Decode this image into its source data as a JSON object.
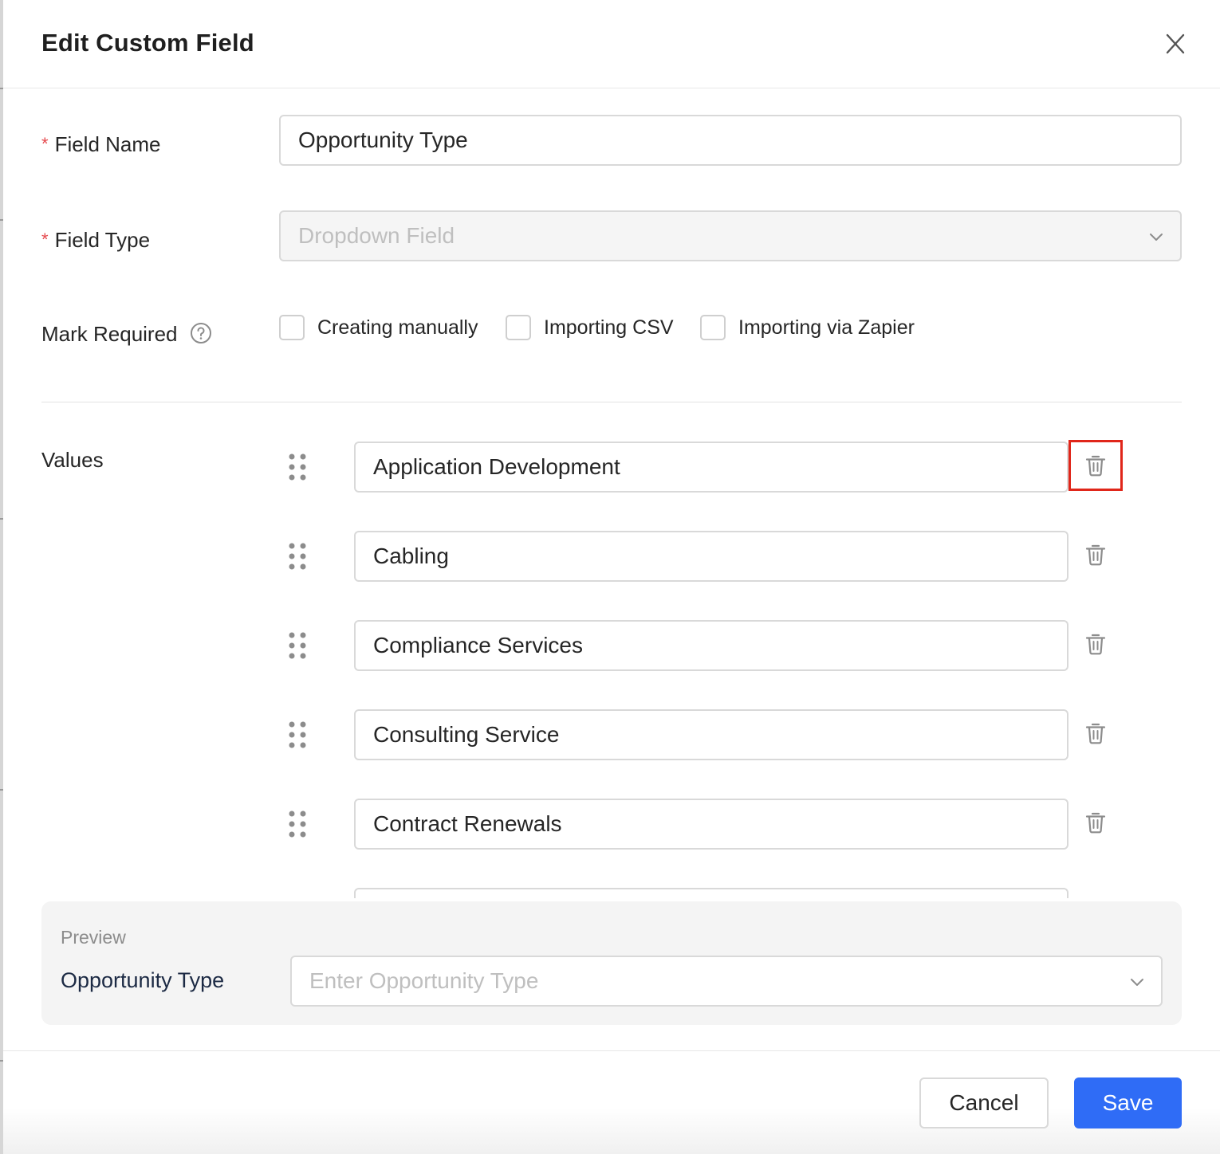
{
  "dialog": {
    "title": "Edit Custom Field",
    "close_icon": "close-icon"
  },
  "field_name": {
    "label": "Field Name",
    "required_mark": "*",
    "value": "Opportunity Type"
  },
  "field_type": {
    "label": "Field Type",
    "required_mark": "*",
    "value": "Dropdown Field",
    "disabled": true
  },
  "mark_required": {
    "label": "Mark Required",
    "help_icon": "question-circle-icon",
    "options": [
      {
        "label": "Creating manually",
        "checked": false
      },
      {
        "label": "Importing CSV",
        "checked": false
      },
      {
        "label": "Importing via Zapier",
        "checked": false
      }
    ]
  },
  "values": {
    "label": "Values",
    "items": [
      {
        "value": "Application Development"
      },
      {
        "value": "Cabling"
      },
      {
        "value": "Compliance Services"
      },
      {
        "value": "Consulting Service"
      },
      {
        "value": "Contract Renewals"
      },
      {
        "value": ""
      }
    ],
    "highlighted_delete_index": 0
  },
  "preview": {
    "label": "Preview",
    "field_label": "Opportunity Type",
    "placeholder": "Enter Opportunity Type"
  },
  "footer": {
    "cancel_label": "Cancel",
    "save_label": "Save"
  },
  "colors": {
    "primary": "#2f6cf6",
    "required": "#e5484d",
    "highlight": "#e0261a"
  }
}
